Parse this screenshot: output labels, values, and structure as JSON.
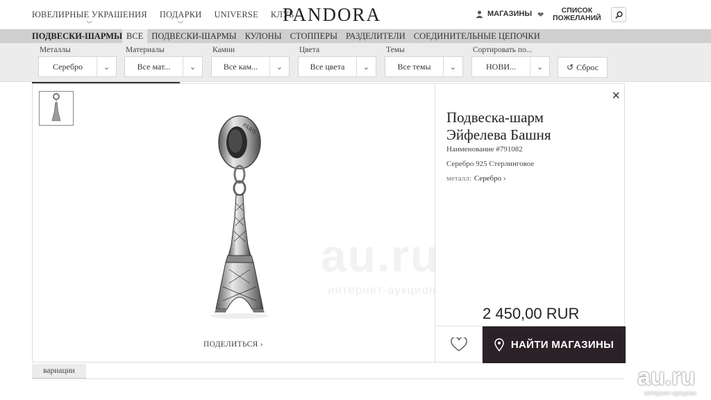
{
  "topnav": {
    "items": [
      {
        "label": "ЮВЕЛИРНЫЕ УКРАШЕНИЯ",
        "has_dropdown": true
      },
      {
        "label": "ПОДАРКИ",
        "has_dropdown": true
      },
      {
        "label": "UNIVERSE",
        "has_dropdown": false
      },
      {
        "label": "КЛУБ",
        "has_dropdown": false
      }
    ],
    "logo": "PANDORA",
    "stores_label": "МАГАЗИНЫ",
    "wishlist_line1": "СПИСОК",
    "wishlist_line2": "ПОЖЕЛАНИЙ",
    "icons": {
      "stores": "person-icon",
      "wishlist": "heart-icon",
      "search": "search-icon"
    }
  },
  "category": {
    "title": "ПОДВЕСКИ-ШАРМЫ",
    "tabs": [
      {
        "label": "ВСЕ",
        "active": true
      },
      {
        "label": "ПОДВЕСКИ-ШАРМЫ",
        "active": false
      },
      {
        "label": "КУЛОНЫ",
        "active": false
      },
      {
        "label": "СТОППЕРЫ",
        "active": false
      },
      {
        "label": "РАЗДЕЛИТЕЛИ",
        "active": false
      },
      {
        "label": "СОЕДИНИТЕЛЬНЫЕ ЦЕПОЧКИ",
        "active": false
      }
    ]
  },
  "filters": [
    {
      "label": "Металлы",
      "value": "Серебро"
    },
    {
      "label": "Материалы",
      "value": "Все мат..."
    },
    {
      "label": "Камни",
      "value": "Все кам..."
    },
    {
      "label": "Цвета",
      "value": "Все цвета"
    },
    {
      "label": "Темы",
      "value": "Все темы"
    },
    {
      "label": "Сортировать по...",
      "value": "НОВИ..."
    }
  ],
  "reset_label": "Сброс",
  "product": {
    "title_line1": "Подвеска-шарм",
    "title_line2": "Эйфелева Башня",
    "ref": "Наименование #791082",
    "material": "Серебро 925 Стерлинговое",
    "metal_label": "металл:",
    "metal_value": "Серебро",
    "price": "2 450,00 RUR",
    "share_label": "ПОДЕЛИТЬСЯ",
    "find_stores_label": "НАЙТИ МАГАЗИНЫ",
    "charm_engraving": "PARIS"
  },
  "variations_label": "вариации",
  "watermark": {
    "big": "au.ru",
    "sub": "интернет-аукцион",
    "corner": "au.ru",
    "corner_sub": "интернет-аукцион"
  },
  "colors": {
    "find_button_bg": "#2b2228",
    "category_bar": "#cfcfcf",
    "filter_bar": "#ececec"
  }
}
